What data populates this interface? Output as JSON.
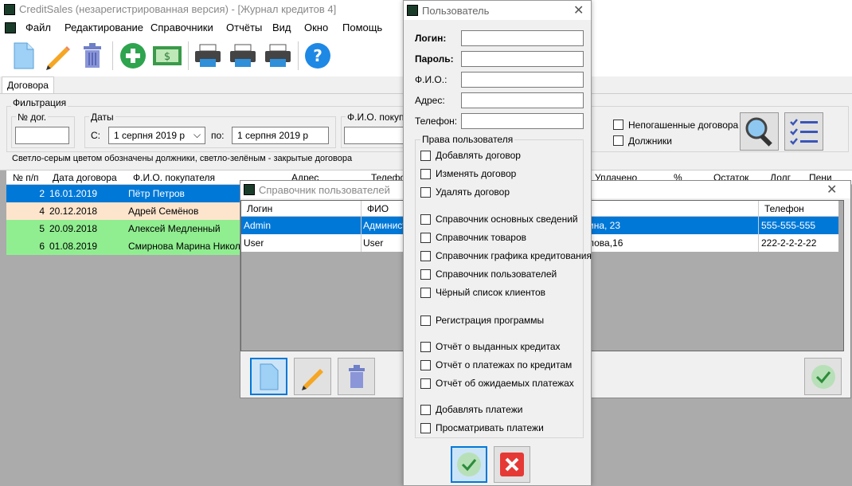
{
  "app": {
    "title": "CreditSales (незарегистрированная версия) - [Журнал кредитов 4]"
  },
  "menu": [
    "Файл",
    "Редактирование",
    "Справочники",
    "Отчёты",
    "Вид",
    "Окно",
    "Помощь"
  ],
  "toolbar_icons": [
    "new-document-icon",
    "edit-pencil-icon",
    "trash-icon",
    "add-plus-icon",
    "money-icon",
    "printer-icon",
    "printer-icon",
    "printer-icon",
    "help-icon"
  ],
  "doc": {
    "tab": "Договора",
    "filter_title": "Фильтрация",
    "num_label": "№ дог.",
    "dates_label": "Даты",
    "from_label": "С:",
    "from_date": "1   серпня   2019 р",
    "to_label": "по:",
    "to_date": "1   серпня   2019 р",
    "buyer_label": "Ф.И.О. покупа",
    "chk_unpaid": "Непогашенные договора",
    "chk_debtors": "Должники",
    "hint": "Светло-серым цветом обозначены должники, светло-зелёным - закрытые договора"
  },
  "grid": {
    "headers": [
      "№ п/п",
      "Дата договора",
      "Ф.И.О. покупателя",
      "Адрес",
      "Телефо",
      "Уплачено",
      "%",
      "Остаток",
      "Долг",
      "Пени"
    ],
    "rows": [
      {
        "n": "2",
        "date": "16.01.2019",
        "name": "Пётр Петров",
        "color": "#0078d7"
      },
      {
        "n": "4",
        "date": "20.12.2018",
        "name": "Адрей Семёнов",
        "color": "#fde5cd"
      },
      {
        "n": "5",
        "date": "20.09.2018",
        "name": "Алексей Медленный",
        "color": "#90ee90"
      },
      {
        "n": "6",
        "date": "01.08.2019",
        "name": "Смирнова Марина Николае",
        "color": "#90ee90"
      }
    ]
  },
  "users_dialog": {
    "title": "Справочник пользователей",
    "headers": [
      "Логин",
      "ФИО",
      "Телефон"
    ],
    "rows": [
      {
        "login": "Admin",
        "fio": "Админист",
        "addr": "ина, 23",
        "phone": "555-555-555"
      },
      {
        "login": "User",
        "fio": "User",
        "addr": "лова,16",
        "phone": "222-2-2-2-22"
      }
    ]
  },
  "user_dialog": {
    "title": "Пользователь",
    "login": "Логин:",
    "password": "Пароль:",
    "fio": "Ф.И.О.:",
    "address": "Адрес:",
    "phone": "Телефон:",
    "rights_title": "Права пользователя",
    "perms": [
      "Добавлять договор",
      "Изменять договор",
      "Удалять договор",
      "Справочник основных сведений",
      "Справочник товаров",
      "Справочник графика кредитования",
      "Справочник пользователей",
      "Чёрный список клиентов",
      "Регистрация программы",
      "Отчёт о выданных кредитах",
      "Отчёт о платежах по кредитам",
      "Отчёт об ожидаемых платежах",
      "Добавлять платежи",
      "Просматривать платежи"
    ]
  }
}
